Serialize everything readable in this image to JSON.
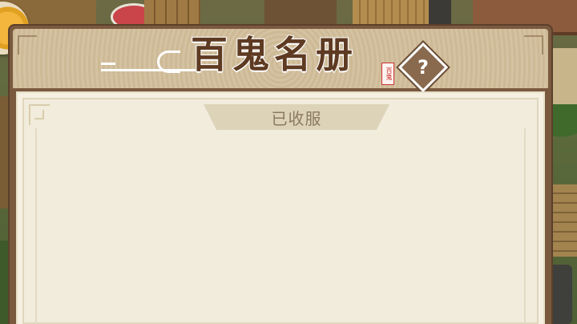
{
  "panel": {
    "title": "百鬼名册",
    "seal_text": "百鬼",
    "help_icon": "?",
    "tab_label": "已收服"
  },
  "colors": {
    "title_fill": "#5e3a22",
    "panel_frame": "#7a5a3f",
    "panel_body": "#f1ecdb",
    "tab_bg": "#ddd3b9",
    "back_button_accent": "#f4b63c"
  }
}
